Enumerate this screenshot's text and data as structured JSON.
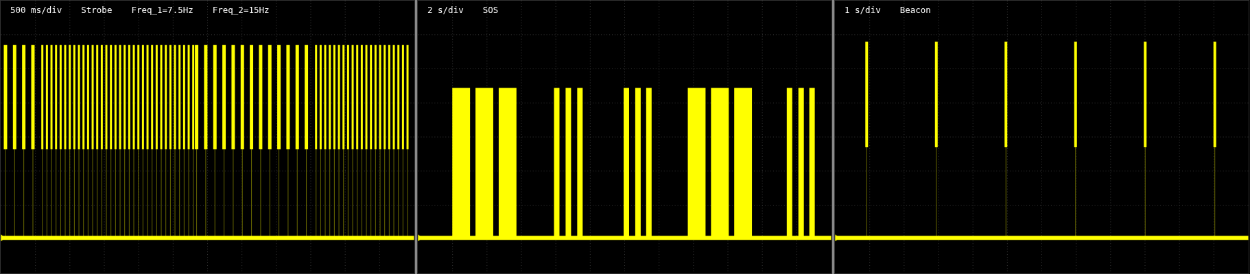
{
  "panels": [
    {
      "kind": "strobe",
      "timebase": "500 ms/div",
      "labels": [
        "Strobe",
        "Freq_1=7.5Hz",
        "Freq_2=15Hz"
      ]
    },
    {
      "kind": "sos",
      "timebase": "2 s/div",
      "labels": [
        "SOS"
      ]
    },
    {
      "kind": "beacon",
      "timebase": "1 s/div",
      "labels": [
        "Beacon"
      ]
    }
  ]
}
